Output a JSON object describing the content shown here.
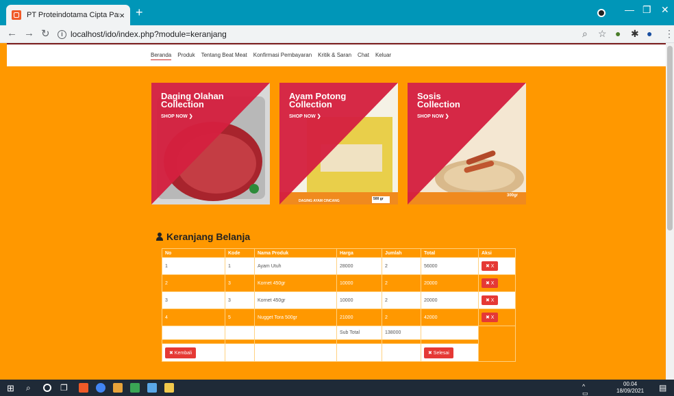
{
  "browser": {
    "tab_title": "PT Proteindotama Cipta Pangan",
    "tab_close": "×",
    "new_tab": "+",
    "url": "localhost/ido/index.php?module=keranjang",
    "info_glyph": "i"
  },
  "site_nav": {
    "items": [
      "Beranda",
      "Produk",
      "Tentang Beat Meat",
      "Konfirmasi Pembayaran",
      "Kritik & Saran",
      "Chat",
      "Keluar"
    ],
    "active": "Beranda"
  },
  "banners": [
    {
      "title": "Daging Olahan Collection",
      "line1": "Daging Olahan",
      "line2": "Collection",
      "cta": "SHOP NOW ❯"
    },
    {
      "title": "Ayam Potong Collection",
      "line1": "Ayam Potong",
      "line2": "Collection",
      "cta": "SHOP NOW ❯",
      "pack_text": "DAGING AYAM CINCANG",
      "pack_weight": "500 gr"
    },
    {
      "title": "Sosis Collection",
      "line1": "Sosis",
      "line2": "Collection",
      "cta": "SHOP NOW ❯",
      "pack_weight": "300gr"
    }
  ],
  "cart": {
    "title": "Keranjang Belanja",
    "headers": [
      "No",
      "Kode",
      "Nama Produk",
      "Harga",
      "Jumlah",
      "Total",
      "Aksi"
    ],
    "rows": [
      {
        "no": "1",
        "kode": "1",
        "nama": "Ayam Utuh",
        "harga": "28000",
        "jumlah": "2",
        "total": "56000",
        "aksi": "✖ X"
      },
      {
        "no": "2",
        "kode": "3",
        "nama": "Kornet 450gr",
        "harga": "10000",
        "jumlah": "2",
        "total": "20000",
        "aksi": "✖ X"
      },
      {
        "no": "3",
        "kode": "3",
        "nama": "Kornet 450gr",
        "harga": "10000",
        "jumlah": "2",
        "total": "20000",
        "aksi": "✖ X"
      },
      {
        "no": "4",
        "kode": "5",
        "nama": "Nugget Tora 500gr",
        "harga": "21000",
        "jumlah": "2",
        "total": "42000",
        "aksi": "✖ X"
      }
    ],
    "subtotal_label": "Sub Total",
    "subtotal_value": "138000",
    "back_button": "✖ Kembali",
    "finish_button": "✖ Selesai"
  },
  "taskbar": {
    "time": "00.04",
    "date": "18/09/2021"
  },
  "colors": {
    "page_bg": "#ff9800",
    "banner_red": "#d4203f",
    "button_red": "#e53935",
    "browser_bar": "#0096b8"
  }
}
